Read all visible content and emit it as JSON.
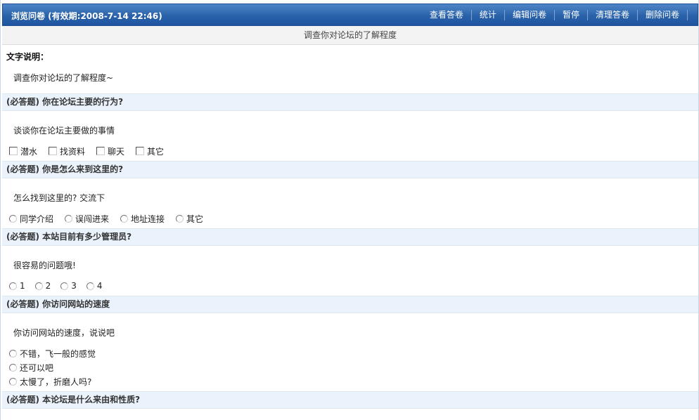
{
  "header": {
    "title": "浏览问卷 (有效期:2008-7-14 22:46)",
    "toolbar": [
      "查看答卷",
      "统计",
      "编辑问卷",
      "暂停",
      "清理答卷",
      "删除问卷"
    ]
  },
  "subtitle": "调查你对论坛的了解程度",
  "intro": {
    "label": "文字说明：",
    "text": "调查你对论坛的了解程度~"
  },
  "questions": [
    {
      "title": "(必答题) 你在论坛主要的行为?",
      "desc": "谈谈你在论坛主要做的事情",
      "options": [
        "潜水",
        "找资料",
        "聊天",
        "其它"
      ]
    },
    {
      "title": "(必答题) 你是怎么来到这里的?",
      "desc": "怎么找到这里的? 交流下",
      "options": [
        "同学介绍",
        "误闯进来",
        "地址连接",
        "其它"
      ]
    },
    {
      "title": "(必答题) 本站目前有多少管理员?",
      "desc": "很容易的问题哦!",
      "options": [
        "1",
        "2",
        "3",
        "4"
      ]
    },
    {
      "title": "(必答题) 你访问网站的速度",
      "desc": "你访问网站的速度，说说吧",
      "options": [
        "不错，飞一般的感觉",
        "还可以吧",
        "太慢了，折磨人吗?"
      ]
    },
    {
      "title": "(必答题) 本论坛是什么来由和性质?"
    }
  ]
}
